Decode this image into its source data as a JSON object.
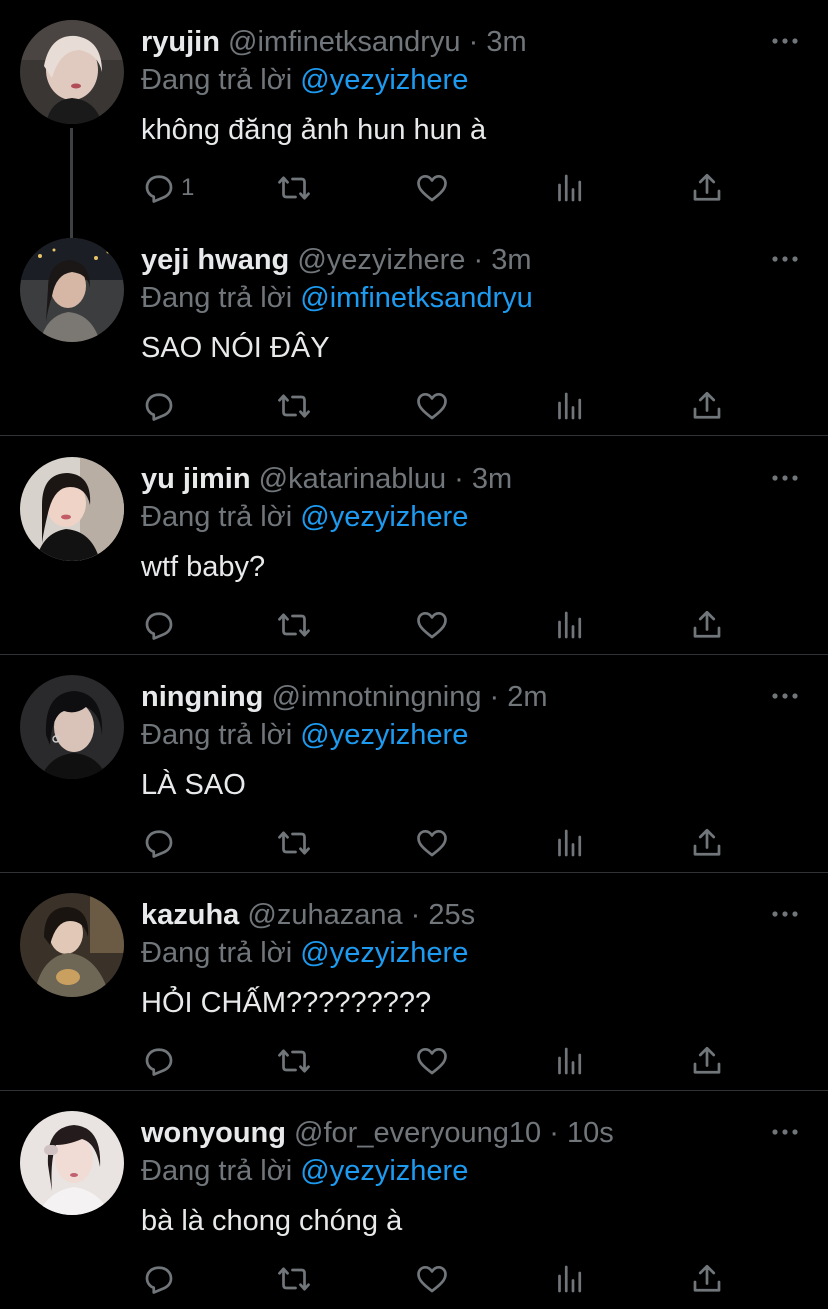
{
  "reply_prefix": "Đang trả lời",
  "colors": {
    "background": "#000000",
    "text": "#e7e9ea",
    "secondary": "#71767b",
    "accent": "#1d9bf0",
    "divider": "#2f3336"
  },
  "tweets": [
    {
      "name": "ryujin",
      "handle": "@imfinetksandryu",
      "dot": "·",
      "time": "3m",
      "replying_to": "@yezyizhere",
      "text": "không đăng ảnh hun hun à",
      "reply_count": "1",
      "avatar_icon": "avatar-photo"
    },
    {
      "name": "yeji hwang",
      "handle": "@yezyizhere",
      "dot": "·",
      "time": "3m",
      "replying_to": "@imfinetksandryu",
      "text": "SAO NÓI ĐÂY",
      "reply_count": "",
      "avatar_icon": "avatar-photo"
    },
    {
      "name": "yu jimin",
      "handle": "@katarinabluu",
      "dot": "·",
      "time": "3m",
      "replying_to": "@yezyizhere",
      "text": "wtf baby?",
      "reply_count": "",
      "avatar_icon": "avatar-photo"
    },
    {
      "name": "ningning",
      "handle": "@imnotningning",
      "dot": "·",
      "time": "2m",
      "replying_to": "@yezyizhere",
      "text": "LÀ SAO",
      "reply_count": "",
      "avatar_icon": "avatar-photo"
    },
    {
      "name": "kazuha",
      "handle": "@zuhazana",
      "dot": "·",
      "time": "25s",
      "replying_to": "@yezyizhere",
      "text": "HỎI CHẤM?????????",
      "reply_count": "",
      "avatar_icon": "avatar-photo"
    },
    {
      "name": "wonyoung",
      "handle": "@for_everyoung10",
      "dot": "·",
      "time": "10s",
      "replying_to": "@yezyizhere",
      "text": "bà là chong chóng à",
      "reply_count": "",
      "avatar_icon": "avatar-photo"
    }
  ],
  "action_icons": [
    "reply-icon",
    "retweet-icon",
    "like-icon",
    "views-icon",
    "share-icon"
  ],
  "more_icon": "more-options-icon"
}
